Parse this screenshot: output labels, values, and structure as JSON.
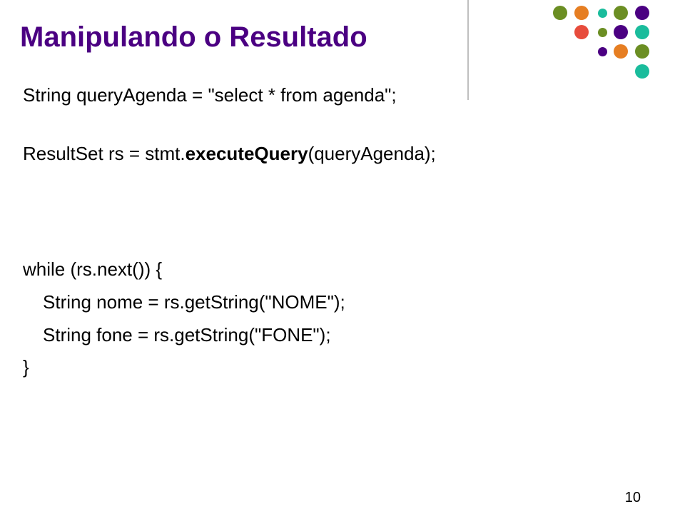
{
  "title": "Manipulando o Resultado",
  "code": {
    "line1": "String queryAgenda = \"select * from agenda\";",
    "line2a": "ResultSet rs = stmt.",
    "line2b": "executeQuery",
    "line2c": "(queryAgenda);",
    "line3": "while (rs.next()) {",
    "line4": "String nome = rs.getString(\"NOME\");",
    "line5": "String fone = rs.getString(\"FONE\");",
    "line6": "}"
  },
  "page_number": "10"
}
